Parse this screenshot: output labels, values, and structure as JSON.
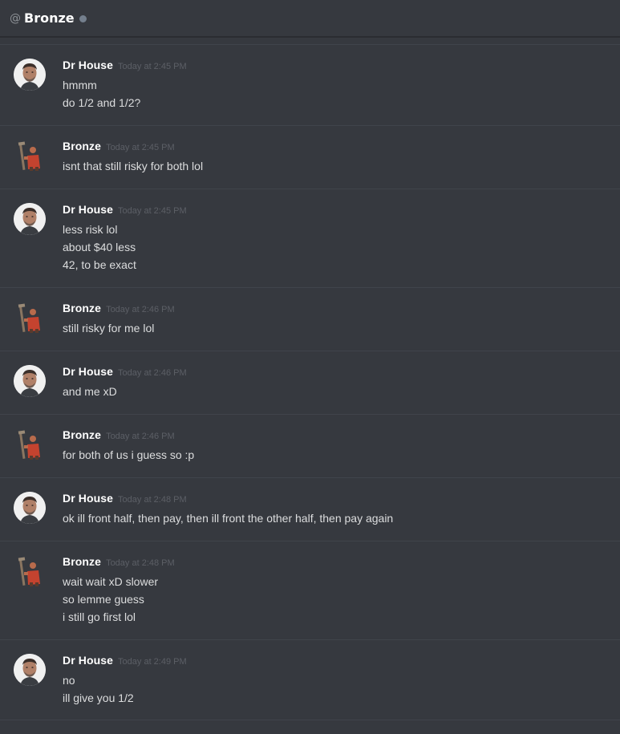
{
  "header": {
    "at_symbol": "@",
    "title": "Bronze",
    "status_color": "#747f8d"
  },
  "icons": {
    "house_avatar": "dr-house-portrait-avatar",
    "bronze_avatar": "bronze-character-avatar"
  },
  "messages": [
    {
      "author": "Dr House",
      "time": "Today at 2:45 PM",
      "lines": [
        "hmmm",
        "do 1/2 and 1/2?"
      ]
    },
    {
      "author": "Bronze",
      "time": "Today at 2:45 PM",
      "lines": [
        "isnt that still risky for both lol"
      ]
    },
    {
      "author": "Dr House",
      "time": "Today at 2:45 PM",
      "lines": [
        "less risk lol",
        "about $40 less",
        "42, to be exact"
      ]
    },
    {
      "author": "Bronze",
      "time": "Today at 2:46 PM",
      "lines": [
        "still risky for me lol"
      ]
    },
    {
      "author": "Dr House",
      "time": "Today at 2:46 PM",
      "lines": [
        "and me xD"
      ]
    },
    {
      "author": "Bronze",
      "time": "Today at 2:46 PM",
      "lines": [
        "for both of us i guess so :p"
      ]
    },
    {
      "author": "Dr House",
      "time": "Today at 2:48 PM",
      "lines": [
        "ok ill front half, then pay, then ill front the other half, then pay again"
      ]
    },
    {
      "author": "Bronze",
      "time": "Today at 2:48 PM",
      "lines": [
        "wait wait xD slower",
        "so lemme guess",
        "i still go first lol"
      ]
    },
    {
      "author": "Dr House",
      "time": "Today at 2:49 PM",
      "lines": [
        "no",
        "ill give you 1/2"
      ]
    }
  ]
}
